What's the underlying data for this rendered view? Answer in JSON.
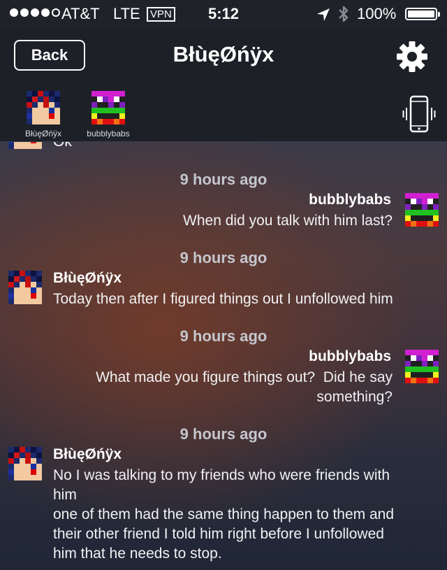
{
  "status_bar": {
    "carrier": "AT&T",
    "network": "LTE",
    "vpn": "VPN",
    "time": "5:12",
    "battery": "100%",
    "signal_bars": 4,
    "battery_level": 1.0
  },
  "nav": {
    "back_label": "Back",
    "title": "BłùęØńÿx"
  },
  "participants": [
    {
      "name": "BłùęØńÿx"
    },
    {
      "name": "bubblybabs"
    }
  ],
  "conversation": {
    "cut_off_text": "Ok",
    "messages": [
      {
        "time": "9 hours ago",
        "sender": "bubblybabs",
        "side": "right",
        "lines": [
          "When did you talk with him last?"
        ]
      },
      {
        "time": "9 hours ago",
        "sender": "BłùęØńÿx",
        "side": "left",
        "lines": [
          "Today then after I figured things out I unfollowed him"
        ]
      },
      {
        "time": "9 hours ago",
        "sender": "bubblybabs",
        "side": "right",
        "lines": [
          "What made you figure things out?  Did he say",
          "something?"
        ]
      },
      {
        "time": "9 hours ago",
        "sender": "BłùęØńÿx",
        "side": "left",
        "lines": [
          "No I was talking to my friends who were friends with",
          "him",
          "one of them had the same thing happen to them and",
          "their other friend I told him right before I unfollowed",
          "him that he needs to stop."
        ]
      }
    ]
  },
  "icons": {
    "gear": "gear-icon",
    "phone_vibrate": "phone-vibrate-icon",
    "location": "location-arrow-icon",
    "bluetooth": "bluetooth-icon"
  },
  "colors": {
    "nav_background": "#1d2027",
    "timestamp": "#c4c6cd",
    "text": "#ffffff"
  }
}
